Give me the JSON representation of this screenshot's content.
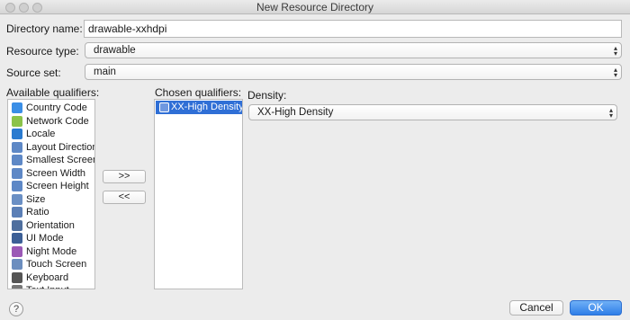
{
  "window": {
    "title": "New Resource Directory"
  },
  "form": {
    "directory_name_label": "Directory name:",
    "directory_name_value": "drawable-xxhdpi",
    "resource_type_label": "Resource type:",
    "resource_type_value": "drawable",
    "source_set_label": "Source set:",
    "source_set_value": "main"
  },
  "qualifiers": {
    "available_label": "Available qualifiers:",
    "chosen_label": "Chosen qualifiers:",
    "available": [
      {
        "label": "Country Code",
        "icon": "country-code-icon",
        "color": "#3a8ee6"
      },
      {
        "label": "Network Code",
        "icon": "network-code-icon",
        "color": "#8bc34a"
      },
      {
        "label": "Locale",
        "icon": "locale-icon",
        "color": "#2a7bd0"
      },
      {
        "label": "Layout Direction",
        "icon": "layout-direction-icon",
        "color": "#5e88c6"
      },
      {
        "label": "Smallest Screen W",
        "icon": "smallest-screen-width-icon",
        "color": "#5e88c6"
      },
      {
        "label": "Screen Width",
        "icon": "screen-width-icon",
        "color": "#5e88c6"
      },
      {
        "label": "Screen Height",
        "icon": "screen-height-icon",
        "color": "#5e88c6"
      },
      {
        "label": "Size",
        "icon": "size-icon",
        "color": "#6a8fc4"
      },
      {
        "label": "Ratio",
        "icon": "ratio-icon",
        "color": "#5b7fb6"
      },
      {
        "label": "Orientation",
        "icon": "orientation-icon",
        "color": "#4f6f9e"
      },
      {
        "label": "UI Mode",
        "icon": "ui-mode-icon",
        "color": "#3c5f96"
      },
      {
        "label": "Night Mode",
        "icon": "night-mode-icon",
        "color": "#9b59b6"
      },
      {
        "label": "Touch Screen",
        "icon": "touch-screen-icon",
        "color": "#6c8ebf"
      },
      {
        "label": "Keyboard",
        "icon": "keyboard-icon",
        "color": "#555555"
      },
      {
        "label": "Text Input",
        "icon": "text-input-icon",
        "color": "#777777"
      }
    ],
    "chosen": [
      {
        "label": "XX-High Density",
        "icon": "density-icon"
      }
    ],
    "add_button": ">>",
    "remove_button": "<<"
  },
  "density": {
    "label": "Density:",
    "value": "XX-High Density"
  },
  "buttons": {
    "help": "?",
    "cancel": "Cancel",
    "ok": "OK"
  }
}
